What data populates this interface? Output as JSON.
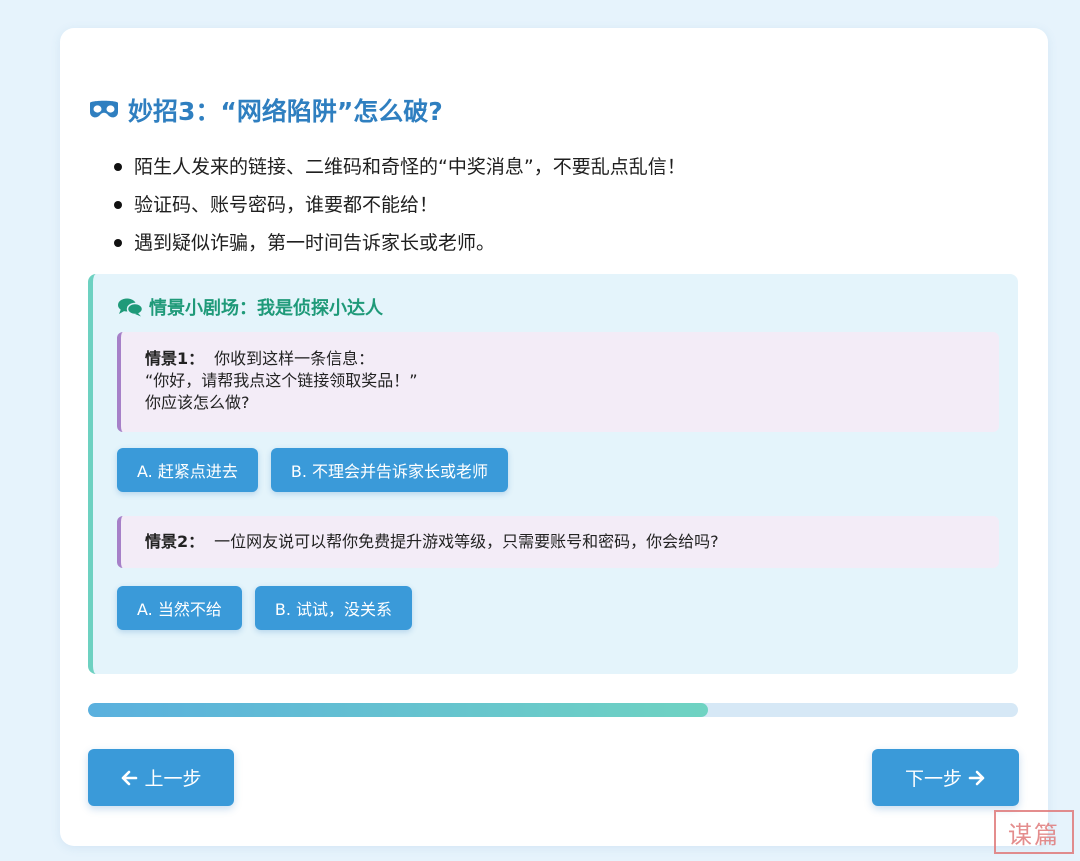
{
  "section": {
    "title": "妙招3：“网络陷阱”怎么破?",
    "icon": "mask-icon",
    "tips": [
      "陌生人发来的链接、二维码和奇怪的“中奖消息”，不要乱点乱信！",
      "验证码、账号密码，谁要都不能给！",
      "遇到疑似诈骗，第一时间告诉家长或老师。"
    ]
  },
  "scenario": {
    "title": "情景小剧场：我是侦探小达人",
    "icon": "comments-icon",
    "cases": [
      {
        "label": "情景1：",
        "lines": [
          "你收到这样一条信息：",
          "“你好，请帮我点这个链接领取奖品！”",
          "你应该怎么做?"
        ],
        "options": [
          "A. 赶紧点进去",
          "B. 不理会并告诉家长或老师"
        ]
      },
      {
        "label": "情景2：",
        "lines": [
          "一位网友说可以帮你免费提升游戏等级，只需要账号和密码，你会给吗?"
        ],
        "options": [
          "A. 当然不给",
          "B. 试试，没关系"
        ]
      }
    ]
  },
  "progress": {
    "value_percent": 66.7
  },
  "nav": {
    "prev_label": "上一步",
    "next_label": "下一步"
  },
  "watermark": {
    "text": "谋篇"
  },
  "colors": {
    "title_blue": "#2f7fc0",
    "button_blue": "#3a9ad9",
    "scene_green": "#1f9a79",
    "case_purple": "#a680c8"
  }
}
